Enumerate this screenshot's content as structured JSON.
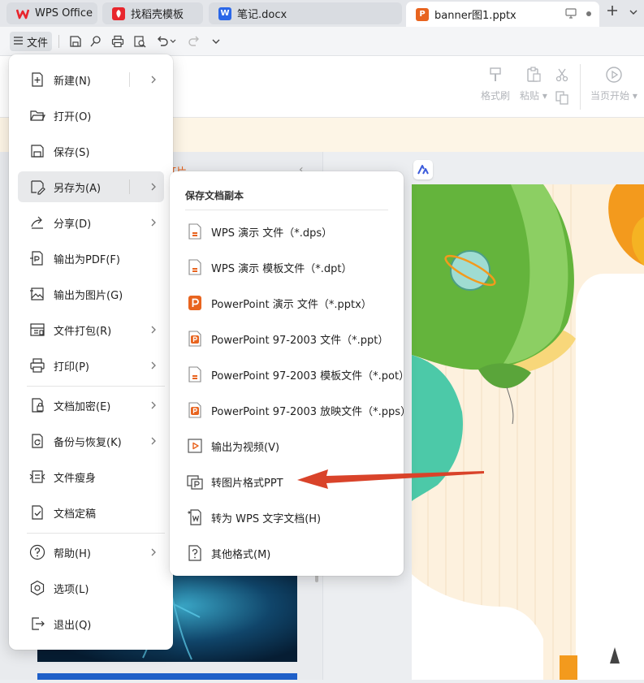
{
  "tabs": [
    {
      "label": "WPS Office",
      "icon": "wps-logo-icon",
      "color": "#e8262d"
    },
    {
      "label": "找稻壳模板",
      "icon": "docer-icon",
      "color": "#e8262d"
    },
    {
      "label": "笔记.docx",
      "icon": "word-icon",
      "color": "#2b67e8"
    },
    {
      "label": "banner图1.pptx",
      "icon": "ppt-icon",
      "color": "#e8641f",
      "active": true
    }
  ],
  "quickbar": {
    "file_label": "文件"
  },
  "ribbon": {
    "format_painter": "格式刷",
    "paste": "粘贴",
    "start_from_current": "当页开始"
  },
  "left_panel": {
    "partial_title": "灯片"
  },
  "file_menu": {
    "items": [
      {
        "label": "新建(N)",
        "icon": "new-file-icon",
        "has_submenu": true
      },
      {
        "label": "打开(O)",
        "icon": "folder-open-icon"
      },
      {
        "label": "保存(S)",
        "icon": "save-icon"
      },
      {
        "label": "另存为(A)",
        "icon": "save-as-icon",
        "has_submenu": true,
        "highlighted": true
      },
      {
        "label": "分享(D)",
        "icon": "share-icon",
        "has_submenu": true
      },
      {
        "label": "输出为PDF(F)",
        "icon": "pdf-export-icon"
      },
      {
        "label": "输出为图片(G)",
        "icon": "image-export-icon"
      },
      {
        "label": "文件打包(R)",
        "icon": "package-icon",
        "has_submenu": true
      },
      {
        "label": "打印(P)",
        "icon": "print-icon",
        "has_submenu": true
      },
      {
        "label": "文档加密(E)",
        "icon": "encrypt-icon",
        "has_submenu": true
      },
      {
        "label": "备份与恢复(K)",
        "icon": "backup-icon",
        "has_submenu": true
      },
      {
        "label": "文件瘦身",
        "icon": "slim-icon"
      },
      {
        "label": "文档定稿",
        "icon": "finalize-icon"
      },
      {
        "label": "帮助(H)",
        "icon": "help-icon",
        "has_submenu": true
      },
      {
        "label": "选项(L)",
        "icon": "options-icon"
      },
      {
        "label": "退出(Q)",
        "icon": "exit-icon"
      }
    ]
  },
  "save_as_menu": {
    "header": "保存文档副本",
    "items": [
      {
        "label": "WPS 演示 文件（*.dps）",
        "icon": "dps-file-icon"
      },
      {
        "label": "WPS 演示 模板文件（*.dpt）",
        "icon": "dpt-file-icon"
      },
      {
        "label": "PowerPoint 演示 文件（*.pptx）",
        "icon": "pptx-file-icon"
      },
      {
        "label": "PowerPoint 97-2003 文件（*.ppt）",
        "icon": "ppt-file-icon"
      },
      {
        "label": "PowerPoint 97-2003 模板文件（*.pot）",
        "icon": "pot-file-icon"
      },
      {
        "label": "PowerPoint 97-2003 放映文件（*.pps）",
        "icon": "pps-file-icon"
      },
      {
        "label": "输出为视频(V)",
        "icon": "video-export-icon"
      },
      {
        "label": "转图片格式PPT",
        "icon": "image-ppt-icon"
      },
      {
        "label": "转为 WPS 文字文档(H)",
        "icon": "wps-writer-convert-icon"
      },
      {
        "label": "其他格式(M)",
        "icon": "other-format-icon"
      }
    ]
  },
  "colors": {
    "accent_orange": "#e8641f",
    "arrow_red": "#d9432a",
    "menu_highlight": "#e8e9eb"
  }
}
